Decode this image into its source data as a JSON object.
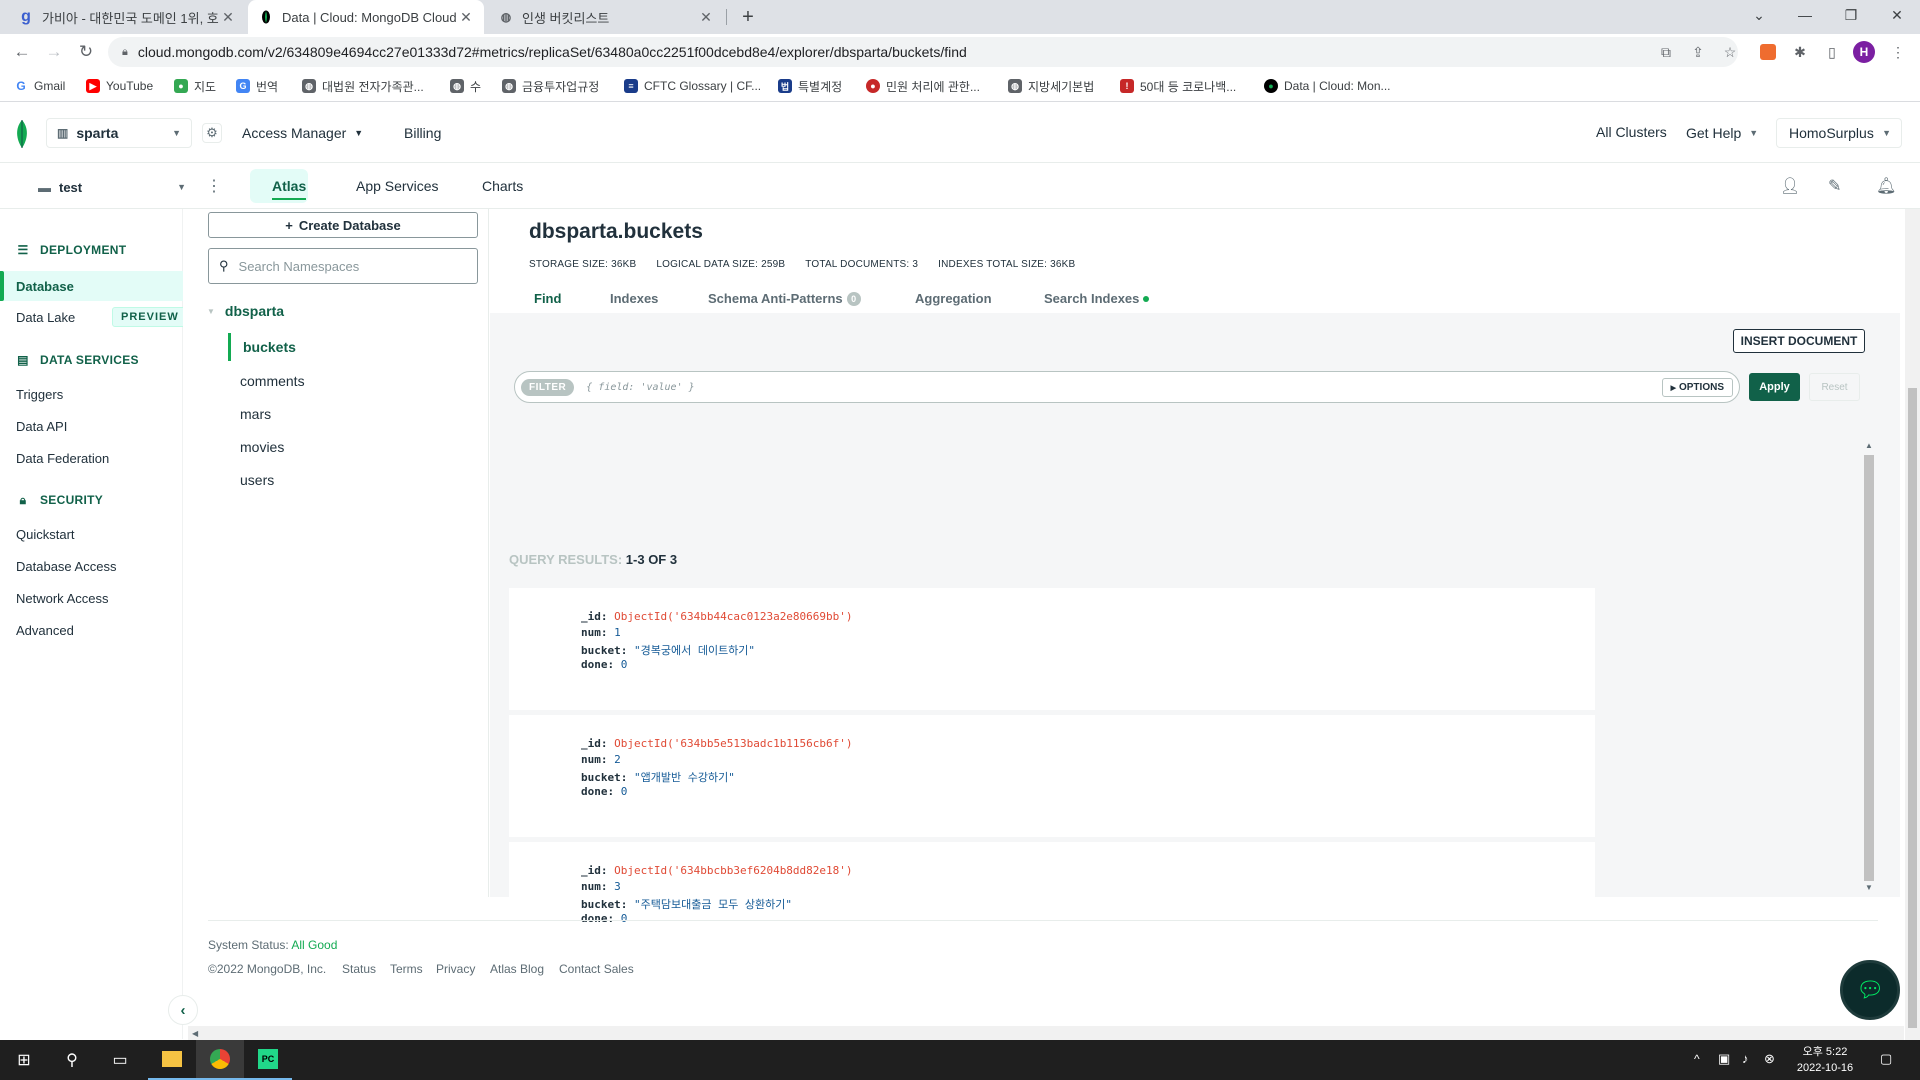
{
  "browser": {
    "tabs": [
      {
        "icon": "gabia-icon",
        "title": "가비아 - 대한민국 도메인 1위, 호"
      },
      {
        "icon": "mongodb-leaf-icon",
        "title": "Data | Cloud: MongoDB Cloud"
      },
      {
        "icon": "globe-icon",
        "title": "인생 버킷리스트"
      }
    ],
    "url": "cloud.mongodb.com/v2/634809e4694cc27e01333d72#metrics/replicaSet/63480a0cc2251f00dcebd8e4/explorer/dbsparta/buckets/find",
    "profile_initial": "H",
    "bookmarks": [
      "Gmail",
      "YouTube",
      "지도",
      "번역",
      "대법원 전자가족관...",
      "수",
      "금융투자업규정",
      "CFTC Glossary | CF...",
      "특별계정",
      "민원 처리에 관한...",
      "지방세기본법",
      "50대 등 코로나백...",
      "Data | Cloud: Mon..."
    ]
  },
  "header": {
    "org": "sparta",
    "access_manager": "Access Manager",
    "billing": "Billing",
    "all_clusters": "All Clusters",
    "get_help": "Get Help",
    "user": "HomoSurplus",
    "project": "test",
    "tabs": [
      "Atlas",
      "App Services",
      "Charts"
    ]
  },
  "sidebar": {
    "deployment": "DEPLOYMENT",
    "database": "Database",
    "data_lake": "Data Lake",
    "preview": "PREVIEW",
    "data_services": "DATA SERVICES",
    "triggers": "Triggers",
    "data_api": "Data API",
    "data_federation": "Data Federation",
    "security": "SECURITY",
    "quickstart": "Quickstart",
    "database_access": "Database Access",
    "network_access": "Network Access",
    "advanced": "Advanced"
  },
  "namespaces": {
    "create_database": "Create Database",
    "search_placeholder": "Search Namespaces",
    "db": "dbsparta",
    "collections": [
      "buckets",
      "comments",
      "mars",
      "movies",
      "users"
    ]
  },
  "collection": {
    "title": "dbsparta.buckets",
    "storage_size": "STORAGE SIZE: 36KB",
    "logical_size": "LOGICAL DATA SIZE: 259B",
    "total_docs": "TOTAL DOCUMENTS: 3",
    "indexes_size": "INDEXES TOTAL SIZE: 36KB",
    "tabs": {
      "find": "Find",
      "indexes": "Indexes",
      "schema": "Schema Anti-Patterns",
      "schema_count": "0",
      "aggregation": "Aggregation",
      "search": "Search Indexes"
    },
    "insert_document": "INSERT DOCUMENT",
    "filter_label": "FILTER",
    "filter_placeholder": "{ field: 'value' }",
    "options": "OPTIONS",
    "apply": "Apply",
    "reset": "Reset",
    "query_results_label": "QUERY RESULTS:",
    "query_results_count": "1-3 OF 3"
  },
  "documents": [
    {
      "id": "ObjectId('634bb44cac0123a2e80669bb')",
      "num": "1",
      "bucket": "\"경복궁에서 데이트하기\"",
      "done": "0"
    },
    {
      "id": "ObjectId('634bb5e513badc1b1156cb6f')",
      "num": "2",
      "bucket": "\"앱개발반 수강하기\"",
      "done": "0"
    },
    {
      "id": "ObjectId('634bbcbb3ef6204b8dd82e18')",
      "num": "3",
      "bucket": "\"주택담보대출금 모두 상환하기\"",
      "done": "0"
    }
  ],
  "footer": {
    "status_label": "System Status:",
    "status_value": "All Good",
    "copyright": "©2022 MongoDB, Inc.",
    "links": [
      "Status",
      "Terms",
      "Privacy",
      "Atlas Blog",
      "Contact Sales"
    ]
  },
  "taskbar": {
    "time": "오후 5:22",
    "date": "2022-10-16"
  },
  "colors": {
    "accent": "#13aa52",
    "dark_green": "#116149",
    "oid_red": "#e04a35"
  }
}
